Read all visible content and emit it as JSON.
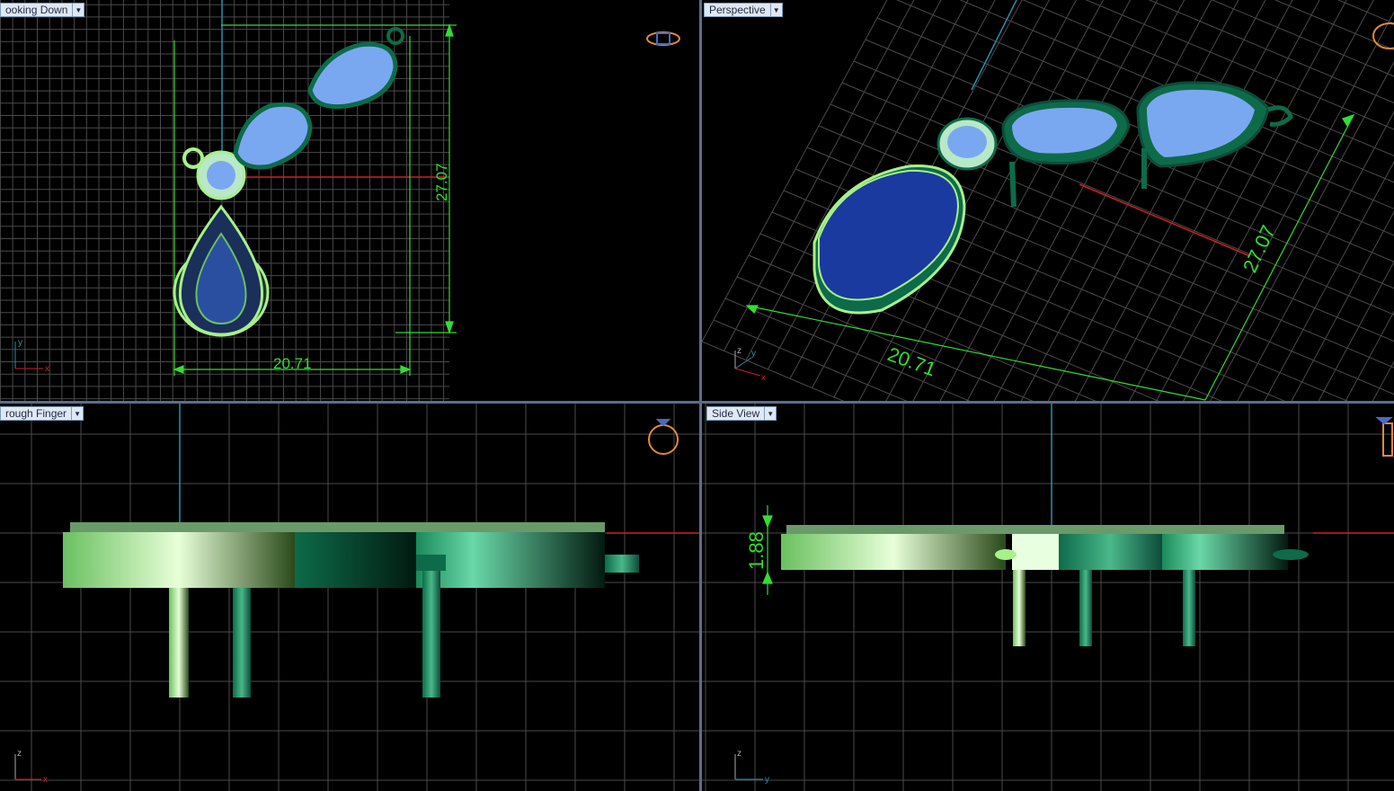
{
  "viewports": {
    "top_left": {
      "label": "ooking Down",
      "dim_width": "20.71",
      "dim_height": "27.07",
      "axis_h": "x",
      "axis_v": "y"
    },
    "top_right": {
      "label": "Perspective",
      "dim_width": "20.71",
      "dim_height": "27.07",
      "axis_h": "x",
      "axis_v": "y",
      "axis_z": "z"
    },
    "bottom_left": {
      "label": "rough Finger",
      "axis_h": "x",
      "axis_v": "z"
    },
    "bottom_right": {
      "label": "Side View",
      "dim_thickness": "1.88",
      "axis_h": "y",
      "axis_v": "z"
    }
  },
  "colors": {
    "grid": "#4a4a4a",
    "dimension": "#33dd33",
    "x_axis": "#cc2222",
    "y_axis": "#2a8fa8",
    "metal_light": "#a8f08a",
    "metal_dark": "#0d6b4a",
    "gem_blue": "#7aa8f0",
    "gem_dark": "#1a3aa0",
    "widget": "#e08a3a"
  },
  "icons": [
    "ring-orientation-icon",
    "dropdown-arrow-icon",
    "axis-triad-icon"
  ]
}
